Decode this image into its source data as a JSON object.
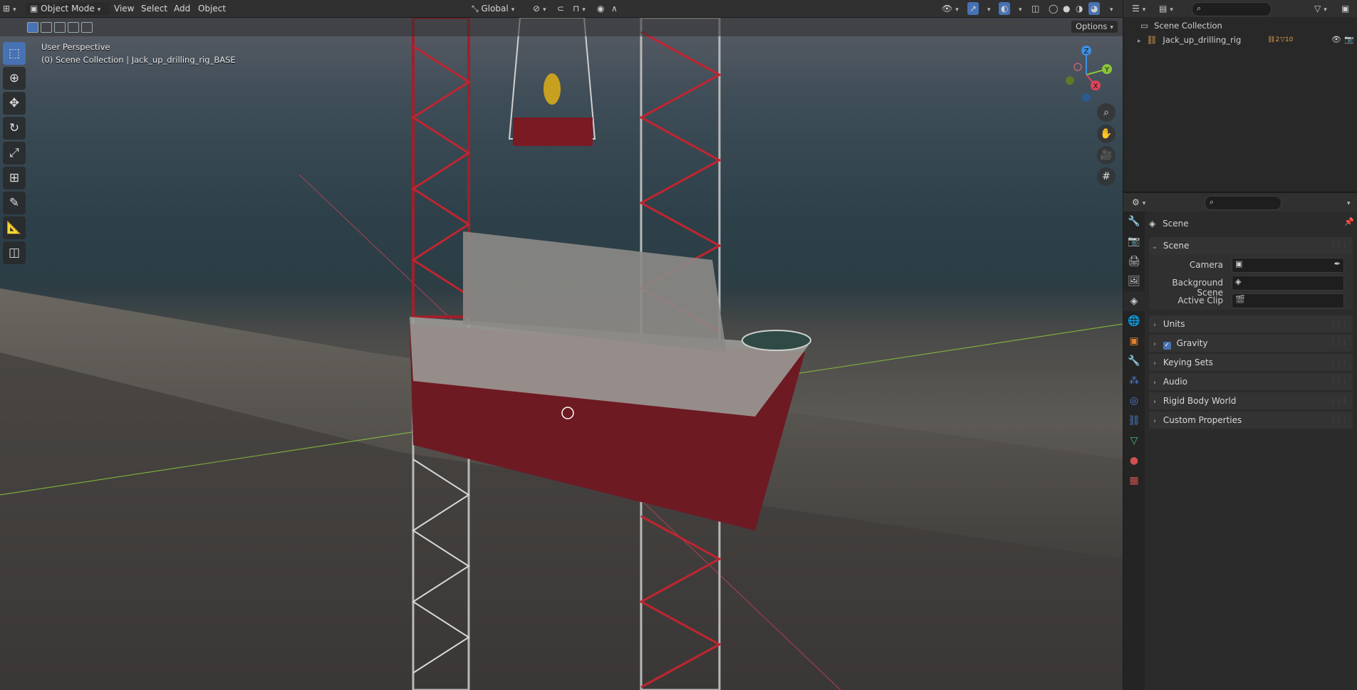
{
  "header": {
    "editor_icon": "3d-viewport-icon",
    "mode": "Object Mode",
    "menus": [
      "View",
      "Select",
      "Add",
      "Object"
    ],
    "orientation": "Global",
    "options_label": "Options"
  },
  "viewport": {
    "view_name": "User Perspective",
    "collection_path": "(0) Scene Collection | Jack_up_drilling_rig_BASE",
    "gizmo": {
      "z": "Z",
      "y": "Y",
      "x": "X"
    },
    "tools": [
      "select-box-icon",
      "cursor-icon",
      "move-icon",
      "rotate-icon",
      "scale-icon",
      "transform-icon",
      "annotate-icon",
      "measure-icon",
      "add-cube-icon"
    ],
    "nav": [
      "zoom-icon",
      "hand-icon",
      "camera-icon",
      "grid-icon"
    ]
  },
  "outliner": {
    "root": "Scene Collection",
    "items": [
      {
        "name": "Jack_up_drilling_rig",
        "badge1": "2",
        "badge2": "10"
      }
    ]
  },
  "properties": {
    "context": "Scene",
    "tabs": [
      "tool-icon",
      "render-icon",
      "output-icon",
      "view-layer-icon",
      "scene-icon",
      "world-icon",
      "object-icon",
      "modifier-icon",
      "particles-icon",
      "physics-icon",
      "constraints-icon",
      "data-icon",
      "material-icon",
      "texture-icon"
    ],
    "scene_panel": {
      "title": "Scene",
      "fields": [
        {
          "label": "Camera",
          "value": ""
        },
        {
          "label": "Background Scene",
          "value": ""
        },
        {
          "label": "Active Clip",
          "value": ""
        }
      ]
    },
    "panels": [
      "Units",
      "Gravity",
      "Keying Sets",
      "Audio",
      "Rigid Body World",
      "Custom Properties"
    ],
    "gravity_checked": true
  },
  "colors": {
    "accent": "#4772b3",
    "x_axis": "#e0435a",
    "y_axis": "#8ac53b",
    "z_axis": "#3d8fe0"
  }
}
